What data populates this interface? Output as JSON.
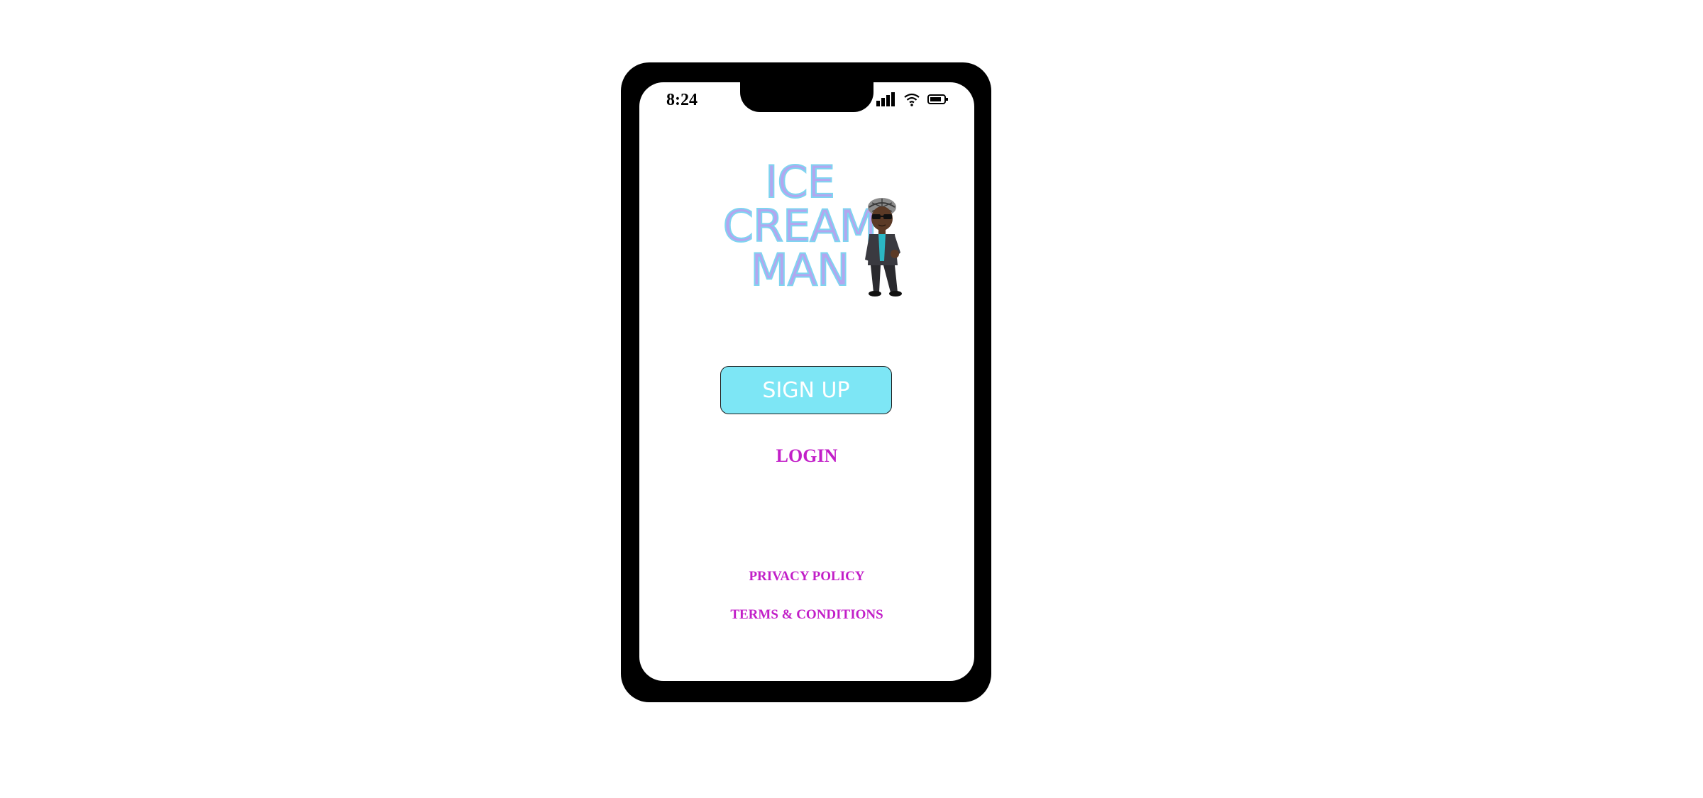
{
  "status_bar": {
    "time": "8:24",
    "icons": [
      "signal-icon",
      "wifi-icon",
      "battery-icon"
    ]
  },
  "logo": {
    "line1": "ICE",
    "line2": "CREAM",
    "line3": "MAN",
    "fill_color": "#b3a6ef",
    "outline_color": "#7fd4f0"
  },
  "actions": {
    "signup_label": "SIGN UP",
    "signup_color": "#7de6f5",
    "login_label": "LOGIN"
  },
  "footer": {
    "privacy_label": "PRIVACY POLICY",
    "terms_label": "TERMS & CONDITIONS",
    "link_color": "#c21fc8"
  }
}
